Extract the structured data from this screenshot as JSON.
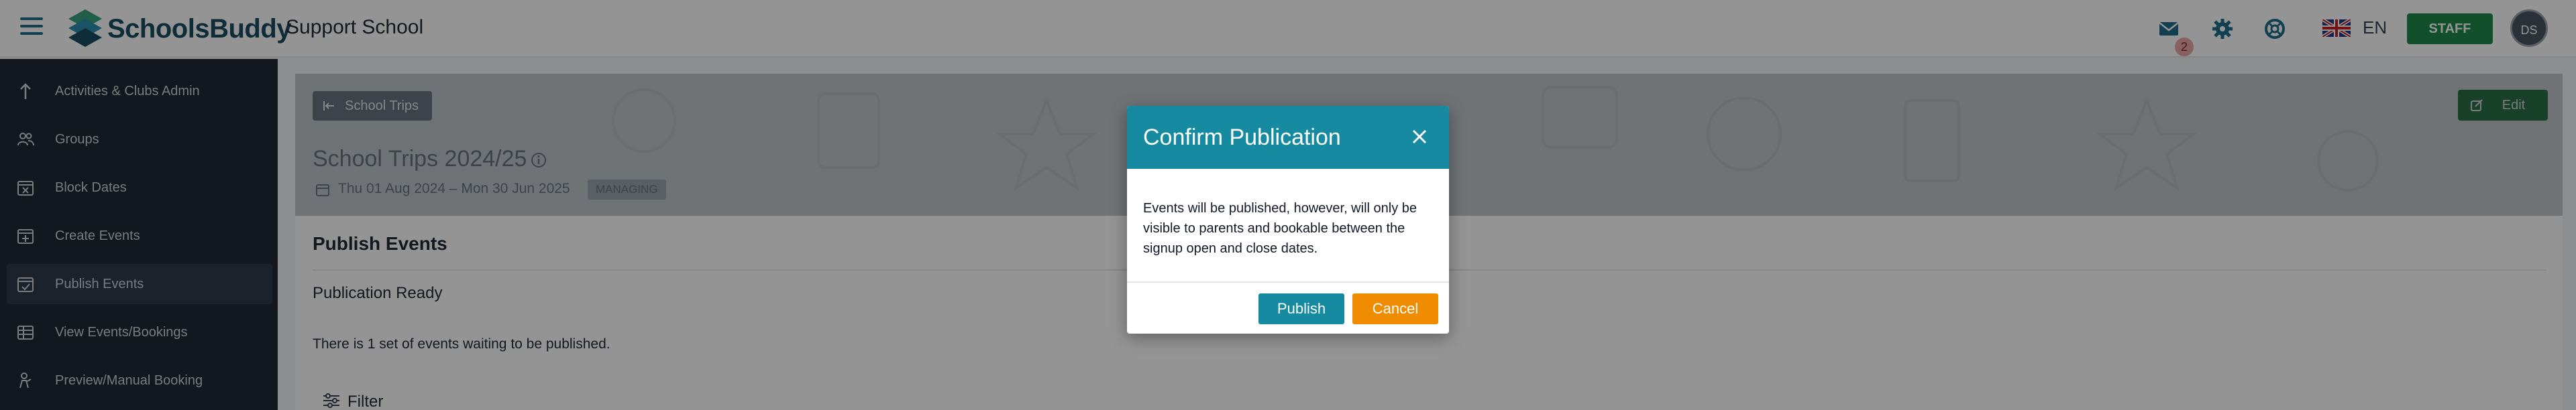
{
  "header": {
    "brand": "SchoolsBuddy",
    "school_name": "Support School",
    "mail_count": "2",
    "language": "EN",
    "staff_label": "STAFF",
    "avatar_initials": "DS",
    "icons": [
      "menu-icon",
      "mail-icon",
      "gear-icon",
      "lifebuoy-icon",
      "uk-flag-icon"
    ]
  },
  "sidebar": {
    "items": [
      {
        "label": "Activities & Clubs Admin",
        "icon": "arrow-up-icon"
      },
      {
        "label": "Groups",
        "icon": "users-icon"
      },
      {
        "label": "Block Dates",
        "icon": "calendar-x-icon"
      },
      {
        "label": "Create Events",
        "icon": "calendar-plus-icon"
      },
      {
        "label": "Publish Events",
        "icon": "calendar-check-icon",
        "active": true
      },
      {
        "label": "View Events/Bookings",
        "icon": "table-icon"
      },
      {
        "label": "Preview/Manual Booking",
        "icon": "person-icon"
      }
    ]
  },
  "main": {
    "breadcrumb": "School Trips",
    "title": "School Trips 2024/25",
    "dates": "Thu 01 Aug 2024 – Mon 30 Jun 2025",
    "status_badge": "MANAGING",
    "edit_label": "Edit",
    "panel_title": "Publish Events",
    "publication_ready": "Publication Ready",
    "waiting_text": "There is 1 set of events waiting to be published.",
    "filter_label": "Filter"
  },
  "modal": {
    "title": "Confirm Publication",
    "body": "Events will be published, however, will only be visible to parents and bookable between the signup open and close dates.",
    "publish_label": "Publish",
    "cancel_label": "Cancel"
  },
  "colors": {
    "accent": "#158aa1",
    "cancel": "#f08c00",
    "staff": "#1f8a4c",
    "sidebar_bg": "#1f2937"
  }
}
